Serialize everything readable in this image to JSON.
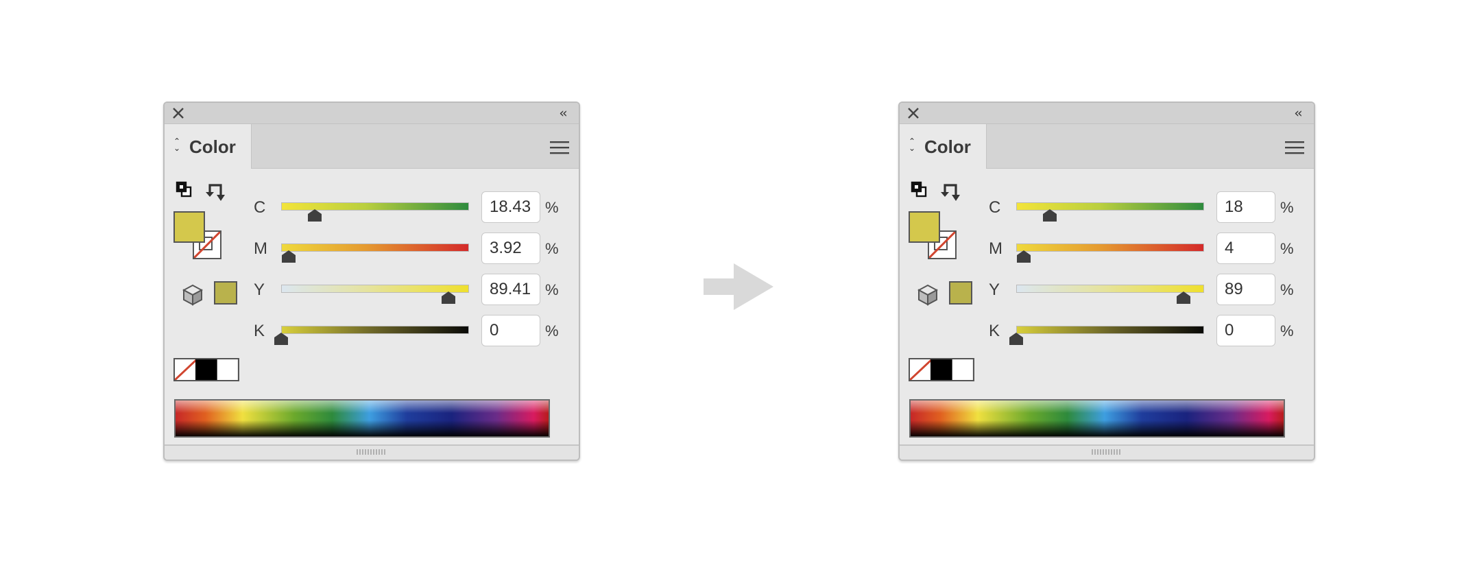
{
  "colors": {
    "fill_swatch": "#d4c84c",
    "websafe_swatch": "#b9b24c",
    "panel_bg": "#e9e9e9",
    "arrow": "#d9d9d9",
    "none_red": "#d0452f"
  },
  "panels": [
    {
      "tab_label": "Color",
      "channels": [
        {
          "label": "C",
          "value": "18.43",
          "unit": "%",
          "level": 0.18
        },
        {
          "label": "M",
          "value": "3.92",
          "unit": "%",
          "level": 0.04
        },
        {
          "label": "Y",
          "value": "89.41",
          "unit": "%",
          "level": 0.89
        },
        {
          "label": "K",
          "value": "0",
          "unit": "%",
          "level": 0
        }
      ]
    },
    {
      "tab_label": "Color",
      "channels": [
        {
          "label": "C",
          "value": "18",
          "unit": "%",
          "level": 0.18
        },
        {
          "label": "M",
          "value": "4",
          "unit": "%",
          "level": 0.04
        },
        {
          "label": "Y",
          "value": "89",
          "unit": "%",
          "level": 0.89
        },
        {
          "label": "K",
          "value": "0",
          "unit": "%",
          "level": 0
        }
      ]
    }
  ],
  "icons": {
    "close": "close-icon",
    "collapse": "double-chevron-left-icon",
    "menu": "hamburger-menu-icon",
    "swap_fill_stroke": "swap-arrow-icon",
    "default_fill_stroke": "default-fill-stroke-icon",
    "gamut": "cube-icon",
    "flow": "right-arrow-icon"
  }
}
